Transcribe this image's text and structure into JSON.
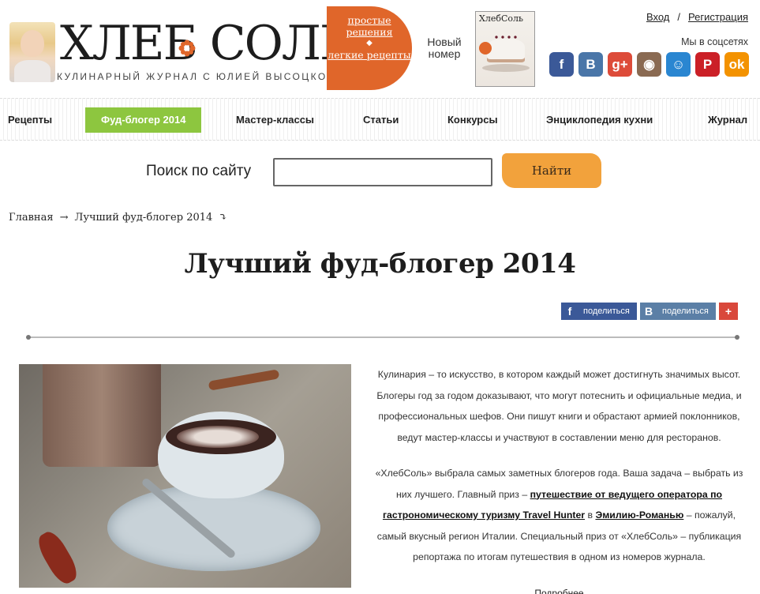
{
  "header": {
    "logo_title": "ХЛЕБ   СОЛЬ",
    "logo_subtitle": "КУЛИНАРНЫЙ ЖУРНАЛ С ЮЛИЕЙ ВЫСОЦКОЙ",
    "promo_link_1": "простые решения",
    "promo_link_2": "легкие рецепты",
    "new_issue": "Новый номер",
    "cover_title": "ХлебСоль",
    "auth_login": "Вход",
    "auth_sep": "/",
    "auth_register": "Регистрация",
    "social_label": "Мы в соцсетях",
    "socials": [
      {
        "name": "facebook-icon",
        "glyph": "f",
        "color": "#3b5998"
      },
      {
        "name": "vk-icon",
        "glyph": "B",
        "color": "#4a76a8"
      },
      {
        "name": "googleplus-icon",
        "glyph": "g+",
        "color": "#dd4b39"
      },
      {
        "name": "instagram-icon",
        "glyph": "◉",
        "color": "#8a6a52"
      },
      {
        "name": "moi-mir-icon",
        "glyph": "☺",
        "color": "#2a86d1"
      },
      {
        "name": "pinterest-icon",
        "glyph": "P",
        "color": "#cb2027"
      },
      {
        "name": "odnoklassniki-icon",
        "glyph": "ok",
        "color": "#f39200"
      }
    ]
  },
  "nav": {
    "items": [
      "Рецепты",
      "Фуд-блогер 2014",
      "Мастер-классы",
      "Статьи",
      "Конкурсы",
      "Энциклопедия кухни",
      "Журнал"
    ],
    "active_index": 1,
    "active_color": "#8dc63f"
  },
  "search": {
    "label": "Поиск по сайту",
    "value": "",
    "button": "Найти"
  },
  "breadcrumb": {
    "home": "Главная",
    "arrow": "→",
    "current": "Лучший фуд-блогер 2014",
    "down_arrow": "⤵"
  },
  "page": {
    "title": "Лучший фуд-блогер 2014"
  },
  "share": {
    "facebook": "поделиться",
    "vk": "поделиться",
    "more": "+"
  },
  "content": {
    "p1": "Кулинария – то искусство, в котором каждый может достигнуть значимых высот. Блогеры год за годом доказывают, что могут потеснить и официальные медиа, и профессиональных шефов. Они пишут книги и обрастают армией поклонников, ведут мастер-классы и участвуют в составлении меню для ресторанов.",
    "p2_start": "«ХлебСоль» выбрала самых заметных блогеров года. Ваша задача – выбрать из них лучшего. Главный приз – ",
    "p2_link1": "путешествие от ведущего оператора по гастрономическому туризму Travel Hunter",
    "p2_mid": " в ",
    "p2_link2": "Эмилию-Романью",
    "p2_end": " – пожалуй, самый вкусный регион Италии. Специальный приз от «ХлебСоль» – публикация репортажа по итогам путешествия в одном из номеров журнала.",
    "more": "Подробнее"
  },
  "colors": {
    "promo": "#e0662a",
    "search_button": "#f2a23c",
    "facebook": "#3b5998",
    "vk": "#5b7fa6",
    "plus": "#d9483b"
  }
}
